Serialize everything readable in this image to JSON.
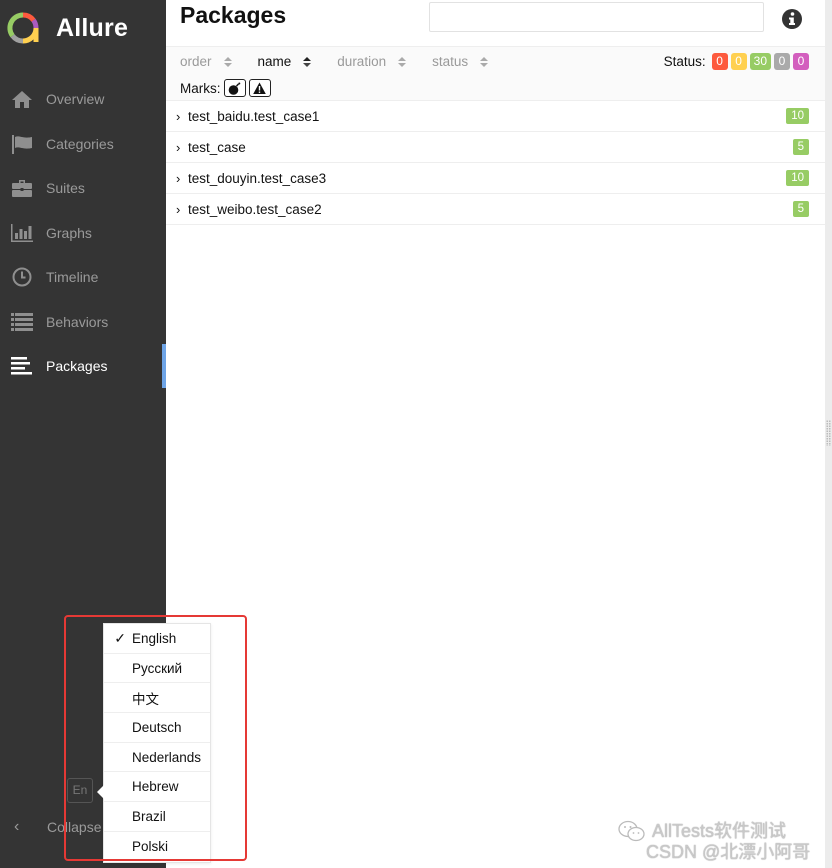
{
  "app": {
    "name": "Allure",
    "logo_colors": [
      "#97cc64",
      "#fd5a3e",
      "#aa5ac0",
      "#ffd050",
      "#a0a0a0"
    ]
  },
  "sidebar": {
    "items": [
      {
        "label": "Overview",
        "icon": "home-icon",
        "active": false
      },
      {
        "label": "Categories",
        "icon": "flag-icon",
        "active": false
      },
      {
        "label": "Suites",
        "icon": "briefcase-icon",
        "active": false
      },
      {
        "label": "Graphs",
        "icon": "bar-chart-icon",
        "active": false
      },
      {
        "label": "Timeline",
        "icon": "clock-icon",
        "active": false
      },
      {
        "label": "Behaviors",
        "icon": "list-icon",
        "active": false
      },
      {
        "label": "Packages",
        "icon": "align-left-icon",
        "active": true
      }
    ],
    "language_button": "En",
    "collapse_label": "Collapse",
    "active_color": "#6ea4e6"
  },
  "main": {
    "title": "Packages",
    "search": {
      "value": "",
      "placeholder": ""
    },
    "sorters": [
      {
        "label": "order",
        "active": false
      },
      {
        "label": "name",
        "active": true
      },
      {
        "label": "duration",
        "active": false
      },
      {
        "label": "status",
        "active": false
      }
    ],
    "marks_label": "Marks:",
    "marks": [
      "flaky-bomb-icon",
      "warning-icon"
    ],
    "status_label": "Status:",
    "status_badges": [
      {
        "status": "failed",
        "count": "0",
        "color": "#fd5a3e"
      },
      {
        "status": "broken",
        "count": "0",
        "color": "#ffd050"
      },
      {
        "status": "passed",
        "count": "30",
        "color": "#97cc64"
      },
      {
        "status": "skipped",
        "count": "0",
        "color": "#aaaaaa"
      },
      {
        "status": "unknown",
        "count": "0",
        "color": "#d35ebe"
      }
    ],
    "packages": [
      {
        "name": "test_baidu.test_case1",
        "count": "10"
      },
      {
        "name": "test_case",
        "count": "5"
      },
      {
        "name": "test_douyin.test_case3",
        "count": "10"
      },
      {
        "name": "test_weibo.test_case2",
        "count": "5"
      }
    ]
  },
  "language_menu": {
    "selected": "English",
    "check_mark": "✓",
    "options": [
      "English",
      "Русский",
      "中文",
      "Deutsch",
      "Nederlands",
      "Hebrew",
      "Brazil",
      "Polski"
    ]
  },
  "watermark": {
    "line1": "AllTests软件测试",
    "line2": "CSDN @北漂小阿哥"
  }
}
